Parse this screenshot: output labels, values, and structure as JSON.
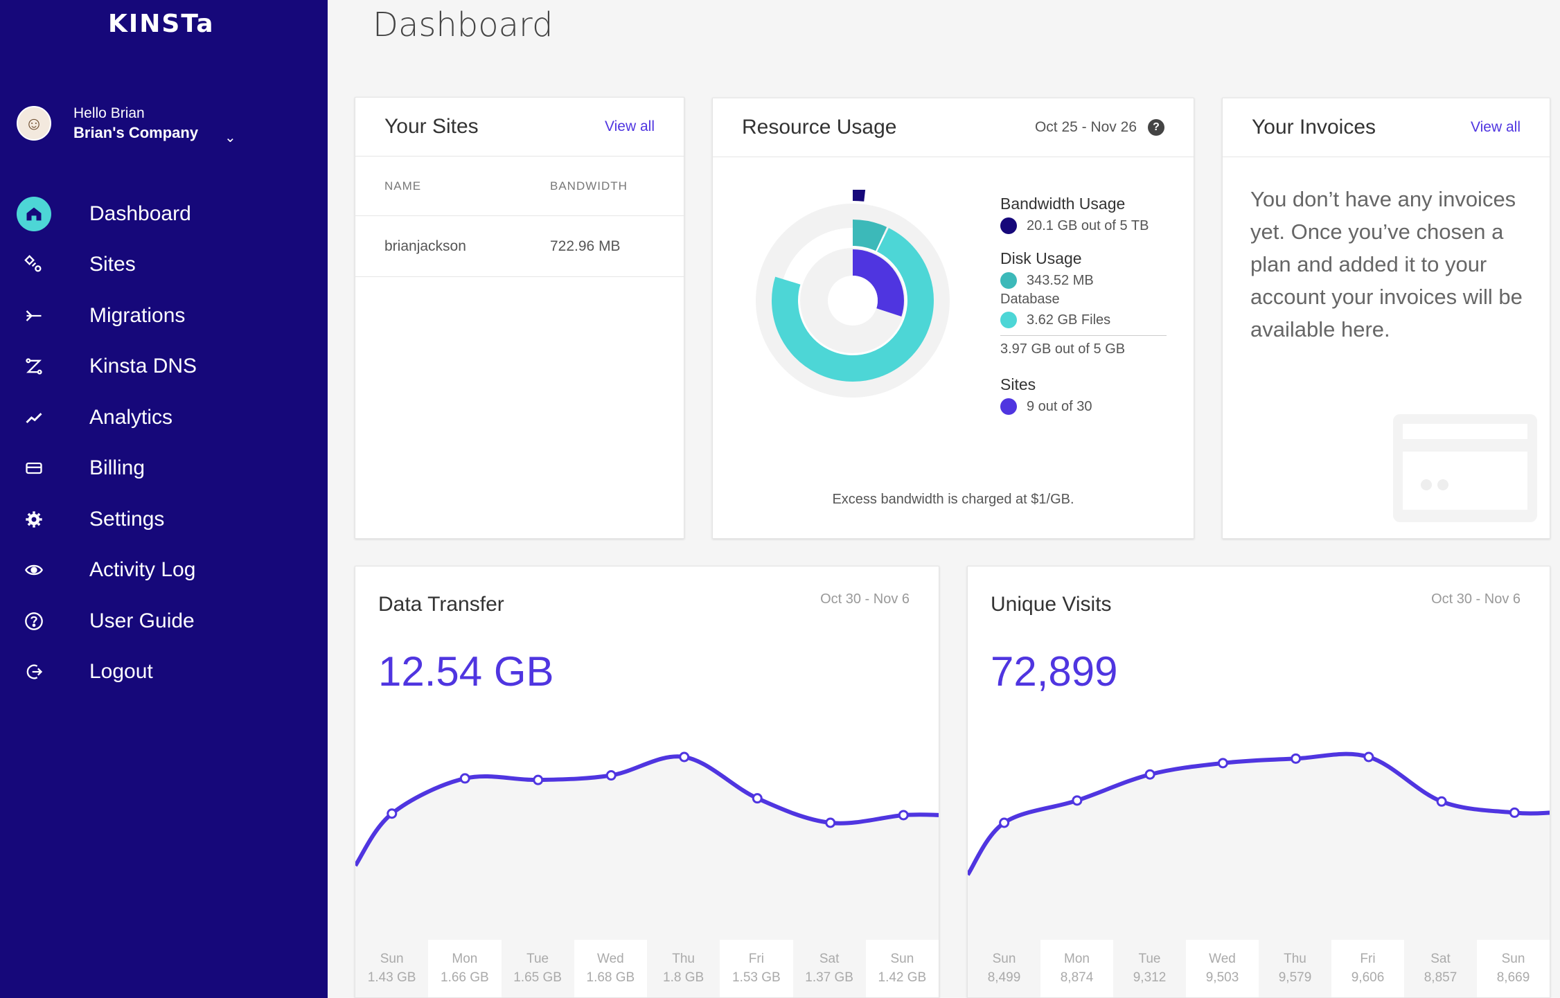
{
  "sidebar": {
    "logo": "KINSTa",
    "hello": "Hello Brian",
    "company": "Brian's Company",
    "items": [
      {
        "label": "Dashboard",
        "icon": "home-icon"
      },
      {
        "label": "Sites",
        "icon": "sites-icon"
      },
      {
        "label": "Migrations",
        "icon": "migrations-icon"
      },
      {
        "label": "Kinsta DNS",
        "icon": "dns-icon"
      },
      {
        "label": "Analytics",
        "icon": "analytics-icon"
      },
      {
        "label": "Billing",
        "icon": "billing-icon"
      },
      {
        "label": "Settings",
        "icon": "gear-icon"
      },
      {
        "label": "Activity Log",
        "icon": "eye-icon"
      },
      {
        "label": "User Guide",
        "icon": "help-icon"
      },
      {
        "label": "Logout",
        "icon": "logout-icon"
      }
    ],
    "active_index": 0
  },
  "page": {
    "title": "Dashboard"
  },
  "sites_card": {
    "title": "Your Sites",
    "view_all": "View all",
    "col_name": "NAME",
    "col_bandwidth": "BANDWIDTH",
    "rows": [
      {
        "name": "brianjackson",
        "bandwidth": "722.96 MB"
      }
    ]
  },
  "resource_card": {
    "title": "Resource Usage",
    "date": "Oct 25 - Nov 26",
    "help": "?",
    "bandwidth_title": "Bandwidth Usage",
    "bandwidth_value": "20.1 GB out of 5 TB",
    "disk_title": "Disk Usage",
    "disk_db_value": "343.52 MB",
    "disk_db_label": "Database",
    "disk_files_value": "3.62 GB Files",
    "disk_total": "3.97 GB out of 5 GB",
    "sites_title": "Sites",
    "sites_value": "9 out of 30",
    "excess_note": "Excess bandwidth is charged at $1/GB.",
    "colors": {
      "bandwidth": "#16087a",
      "database": "#3cb9b9",
      "files": "#4dd6d6",
      "sites": "#4f35e0",
      "track": "#f2f2f2"
    },
    "usage": {
      "bandwidth_fraction": 0.004,
      "database_fraction": 0.069,
      "files_fraction": 0.724,
      "sites_fraction": 0.3
    }
  },
  "invoices_card": {
    "title": "Your Invoices",
    "view_all": "View all",
    "message": "You don’t have any invoices yet. Once you’ve chosen a plan and added it to your account your invoices will be available here."
  },
  "data_transfer": {
    "title": "Data Transfer",
    "date": "Oct 30 - Nov 6",
    "value": "12.54 GB",
    "days": [
      {
        "day": "Sun",
        "value": "1.43 GB"
      },
      {
        "day": "Mon",
        "value": "1.66 GB"
      },
      {
        "day": "Tue",
        "value": "1.65 GB"
      },
      {
        "day": "Wed",
        "value": "1.68 GB"
      },
      {
        "day": "Thu",
        "value": "1.8 GB"
      },
      {
        "day": "Fri",
        "value": "1.53 GB"
      },
      {
        "day": "Sat",
        "value": "1.37 GB"
      },
      {
        "day": "Sun",
        "value": "1.42 GB"
      }
    ]
  },
  "unique_visits": {
    "title": "Unique Visits",
    "date": "Oct 30 - Nov 6",
    "value": "72,899",
    "days": [
      {
        "day": "Sun",
        "value": "8,499"
      },
      {
        "day": "Mon",
        "value": "8,874"
      },
      {
        "day": "Tue",
        "value": "9,312"
      },
      {
        "day": "Wed",
        "value": "9,503"
      },
      {
        "day": "Thu",
        "value": "9,579"
      },
      {
        "day": "Fri",
        "value": "9,606"
      },
      {
        "day": "Sat",
        "value": "8,857"
      },
      {
        "day": "Sun",
        "value": "8,669"
      }
    ]
  },
  "chart_data": [
    {
      "type": "line",
      "title": "Data Transfer",
      "categories": [
        "Sun",
        "Mon",
        "Tue",
        "Wed",
        "Thu",
        "Fri",
        "Sat",
        "Sun"
      ],
      "series": [
        {
          "values": [
            1.43,
            1.66,
            1.65,
            1.68,
            1.8,
            1.53,
            1.37,
            1.42
          ]
        }
      ],
      "unit": "GB",
      "grid": false,
      "color": "#4f35e0"
    },
    {
      "type": "line",
      "title": "Unique Visits",
      "categories": [
        "Sun",
        "Mon",
        "Tue",
        "Wed",
        "Thu",
        "Fri",
        "Sat",
        "Sun"
      ],
      "series": [
        {
          "values": [
            8499,
            8874,
            9312,
            9503,
            9579,
            9606,
            8857,
            8669
          ]
        }
      ],
      "grid": false,
      "color": "#4f35e0"
    }
  ]
}
